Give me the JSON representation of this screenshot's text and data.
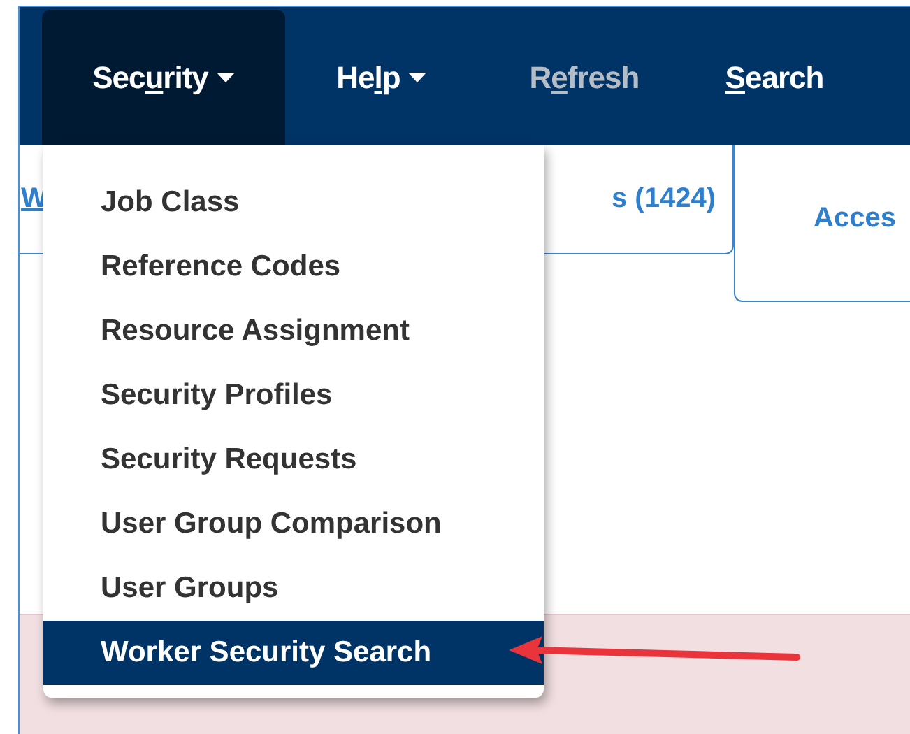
{
  "nav": [
    {
      "label_parts": [
        {
          "text": "Sec",
          "underlined": false
        },
        {
          "text": "u",
          "underlined": true
        },
        {
          "text": "rity",
          "underlined": false
        }
      ],
      "has_menu": true,
      "open": true,
      "disabled": false
    },
    {
      "label_parts": [
        {
          "text": "He",
          "underlined": false
        },
        {
          "text": "l",
          "underlined": true
        },
        {
          "text": "p",
          "underlined": false
        }
      ],
      "has_menu": true,
      "open": false,
      "disabled": false
    },
    {
      "label_parts": [
        {
          "text": "R",
          "underlined": false
        },
        {
          "text": "e",
          "underlined": true
        },
        {
          "text": "fresh",
          "underlined": false
        }
      ],
      "has_menu": false,
      "open": false,
      "disabled": true
    },
    {
      "label_parts": [
        {
          "text": "S",
          "underlined": true
        },
        {
          "text": "earch",
          "underlined": false
        }
      ],
      "has_menu": false,
      "open": false,
      "disabled": false
    }
  ],
  "tabs": [
    {
      "label": "W",
      "selected": false
    },
    {
      "label": "s (1424)",
      "selected": false
    },
    {
      "label": "Acces",
      "selected": true
    }
  ],
  "menu": [
    {
      "label": "Job Class",
      "selected": false
    },
    {
      "label": "Reference Codes",
      "selected": false
    },
    {
      "label": "Resource Assignment",
      "selected": false
    },
    {
      "label": "Security Profiles",
      "selected": false
    },
    {
      "label": "Security Requests",
      "selected": false
    },
    {
      "label": "User Group Comparison",
      "selected": false
    },
    {
      "label": "User Groups",
      "selected": false
    },
    {
      "label": "Worker Security Search",
      "selected": true
    }
  ],
  "annotation": {
    "kind": "arrow",
    "color": "#e8343a"
  }
}
